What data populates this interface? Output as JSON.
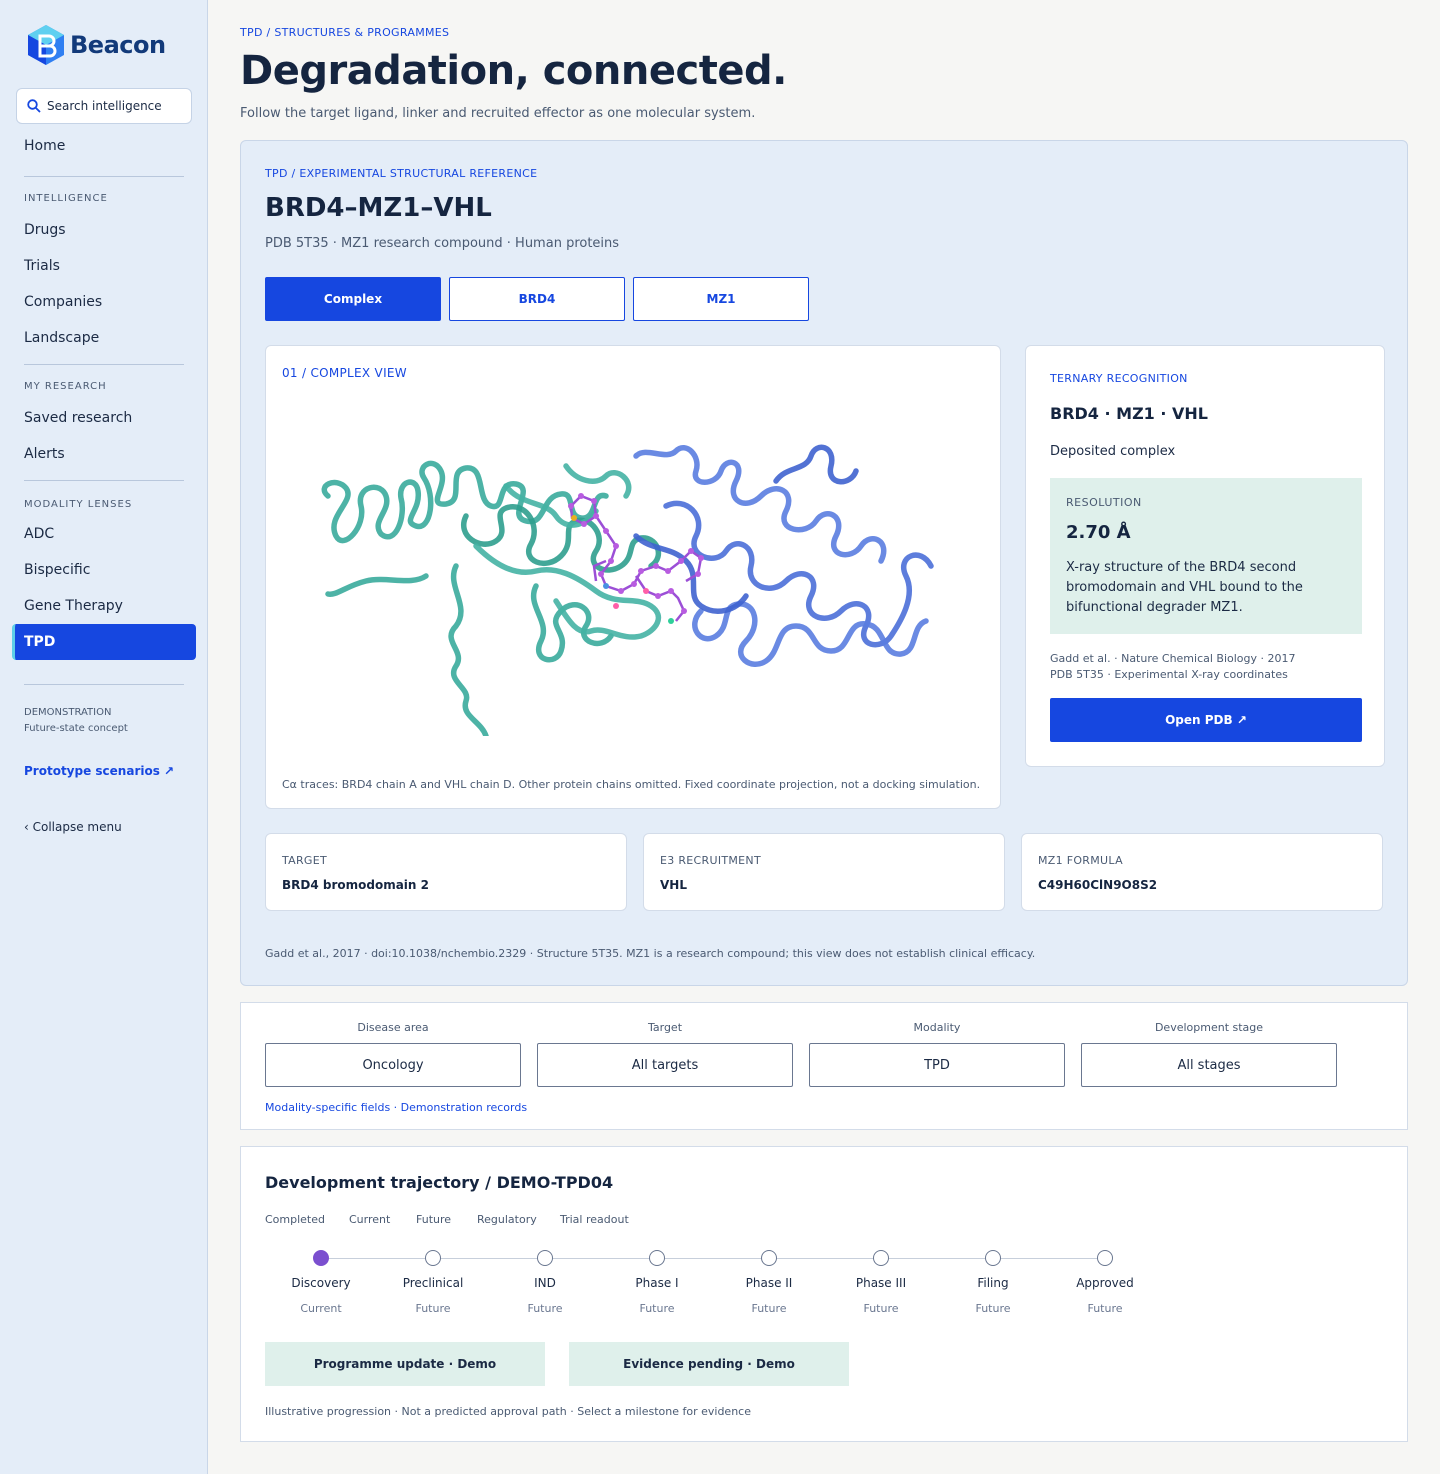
{
  "brand": {
    "name": "Beacon"
  },
  "sidebar": {
    "search_placeholder": "Search intelligence",
    "home": "Home",
    "sections": {
      "intelligence": "INTELLIGENCE",
      "my_research": "MY RESEARCH",
      "modality_lenses": "MODALITY LENSES"
    },
    "intelligence_items": [
      "Drugs",
      "Trials",
      "Companies",
      "Landscape"
    ],
    "research_items": [
      "Saved research",
      "Alerts"
    ],
    "modality_items": [
      "ADC",
      "Bispecific",
      "Gene Therapy",
      "TPD"
    ],
    "active_item": "TPD",
    "demo_label": "DEMONSTRATION",
    "demo_sub": "Future-state concept",
    "prototype_link": "Prototype scenarios ↗",
    "collapse": "‹  Collapse menu"
  },
  "header": {
    "breadcrumb": "TPD / STRUCTURES & PROGRAMMES",
    "title": "Degradation, connected.",
    "subtitle": "Follow the target ligand, linker and recruited effector as one molecular system."
  },
  "structure": {
    "kicker": "TPD / EXPERIMENTAL STRUCTURAL REFERENCE",
    "title": "BRD4–MZ1–VHL",
    "subtitle": "PDB 5T35 · MZ1 research compound · Human proteins",
    "tabs": [
      "Complex",
      "BRD4",
      "MZ1"
    ],
    "active_tab": "Complex",
    "viewer": {
      "label": "01 / COMPLEX VIEW",
      "caption": "Cα traces: BRD4 chain A and VHL chain D. Other protein chains omitted. Fixed coordinate projection, not a docking simulation."
    },
    "info": {
      "kicker": "TERNARY RECOGNITION",
      "title": "BRD4 · MZ1 · VHL",
      "subtitle": "Deposited complex",
      "resolution_label": "RESOLUTION",
      "resolution_value": "2.70 Å",
      "description": "X-ray structure of the BRD4 second bromodomain and VHL bound to the bifunctional degrader MZ1.",
      "citation": "Gadd et al. · Nature Chemical Biology · 2017",
      "pdb_note": "PDB 5T35 · Experimental X-ray coordinates",
      "open_button": "Open PDB ↗"
    },
    "facts": [
      {
        "label": "TARGET",
        "value": "BRD4 bromodomain 2"
      },
      {
        "label": "E3 RECRUITMENT",
        "value": "VHL"
      },
      {
        "label": "MZ1 FORMULA",
        "value": "C49H60ClN9O8S2"
      }
    ],
    "footnote": "Gadd et al., 2017 · doi:10.1038/nchembio.2329 · Structure 5T35. MZ1 is a research compound; this view does not establish clinical efficacy.",
    "colors": {
      "brd4": "#3aab9c",
      "vhl": "#5a7de0",
      "ligand": "#9b4fd6"
    }
  },
  "filters": {
    "items": [
      {
        "label": "Disease area",
        "value": "Oncology"
      },
      {
        "label": "Target",
        "value": "All targets"
      },
      {
        "label": "Modality",
        "value": "TPD"
      },
      {
        "label": "Development stage",
        "value": "All stages"
      }
    ],
    "footnote": "Modality-specific fields · Demonstration records"
  },
  "trajectory": {
    "title": "Development trajectory / DEMO-TPD04",
    "legend": [
      "Completed",
      "Current",
      "Future",
      "Regulatory",
      "Trial readout"
    ],
    "stages": [
      {
        "name": "Discovery",
        "status": "Current"
      },
      {
        "name": "Preclinical",
        "status": "Future"
      },
      {
        "name": "IND",
        "status": "Future"
      },
      {
        "name": "Phase I",
        "status": "Future"
      },
      {
        "name": "Phase II",
        "status": "Future"
      },
      {
        "name": "Phase III",
        "status": "Future"
      },
      {
        "name": "Filing",
        "status": "Future"
      },
      {
        "name": "Approved",
        "status": "Future"
      }
    ],
    "pills": [
      "Programme update · Demo",
      "Evidence pending · Demo"
    ],
    "footnote": "Illustrative progression · Not a predicted approval path · Select a milestone for evidence"
  }
}
